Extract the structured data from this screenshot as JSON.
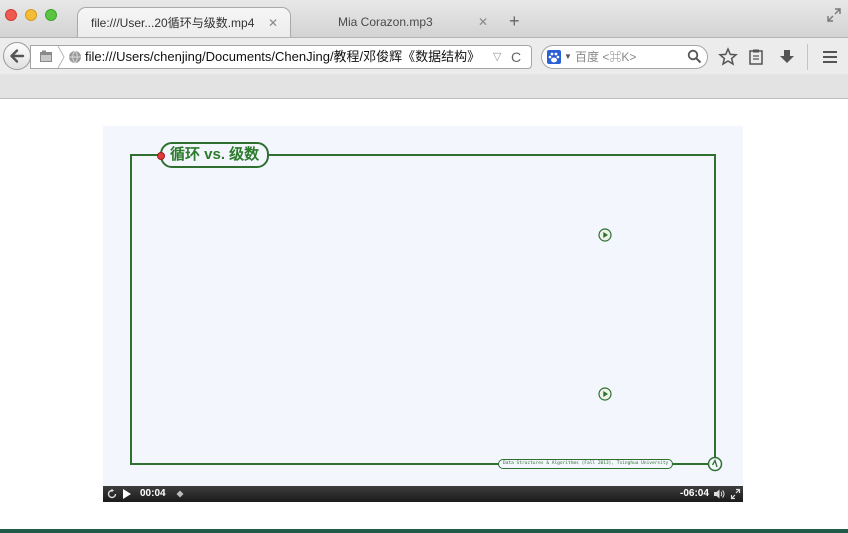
{
  "tabs": [
    {
      "label": "file:///User...20循环与级数.mp4",
      "close": "✕",
      "active": true
    },
    {
      "label": "Mia Corazon.mp3",
      "close": "✕",
      "active": false
    }
  ],
  "new_tab_label": "+",
  "navbar": {
    "url": "file:///Users/chenjing/Documents/ChenJing/教程/邓俊辉《数据结构》",
    "dropdown": "▽",
    "reload": "C"
  },
  "search": {
    "placeholder": "百度 <⌘K>",
    "engine": "baidu-icon"
  },
  "video": {
    "slide_title": "循环 vs. 级数",
    "footer_text": "Data Structures & Algorithms (Fall 2013), Tsinghua University",
    "current_time": "00:04",
    "remaining_time": "-06:04",
    "progress": 0.01
  },
  "icons": {
    "back": "back-arrow-icon",
    "sidebar": "sidebar-icon",
    "globe": "globe-icon",
    "bookmark": "star-icon",
    "reading_list": "clipboard-icon",
    "downloads": "download-icon",
    "menu": "hamburger-menu-icon"
  },
  "colors": {
    "slide_green": "#2f6f30",
    "slide_background": "#f3f7fd",
    "controls_background": "#1b1b1b"
  }
}
